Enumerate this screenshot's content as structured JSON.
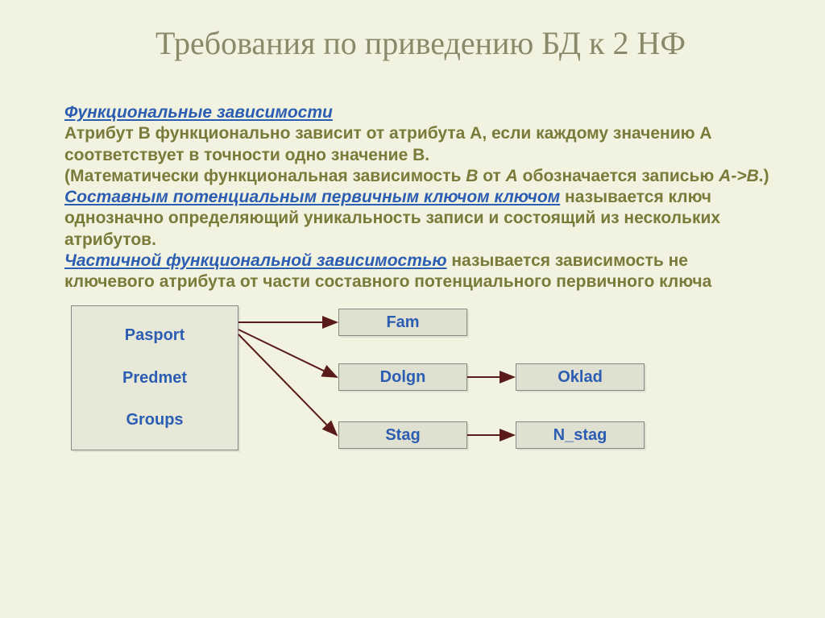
{
  "title": "Требования по приведению БД к 2 НФ",
  "text": {
    "h1": "Функциональные зависимости",
    "p1a": "Атрибут В функционально зависит от атрибута А, если каждому значению А соответствует в точности одно значение В.",
    "p1b_open": "(",
    "p1b": "Математически функциональная зависимость ",
    "p1b_B": "В",
    "p1b_ot": " от ",
    "p1b_A": "А",
    "p1b_tail": " обозначается записью ",
    "p1b_expr": "А->В",
    "p1b_close": ".)",
    "h2": "Составным потенциальным первичным ключом ключом",
    "p2": " называется ключ однозначно определяющий уникальность записи и состоящий из нескольких атрибутов.",
    "h3": "Частичной функциональной зависимостью",
    "p3": " называется зависимость не ключевого атрибута от части составного потенциального первичного  ключа"
  },
  "diagram": {
    "pasport": "Pasport",
    "predmet": "Predmet",
    "groups": "Groups",
    "fam": "Fam",
    "dolgn": "Dolgn",
    "oklad": "Oklad",
    "stag": "Stag",
    "n_stag": "N_stag"
  }
}
